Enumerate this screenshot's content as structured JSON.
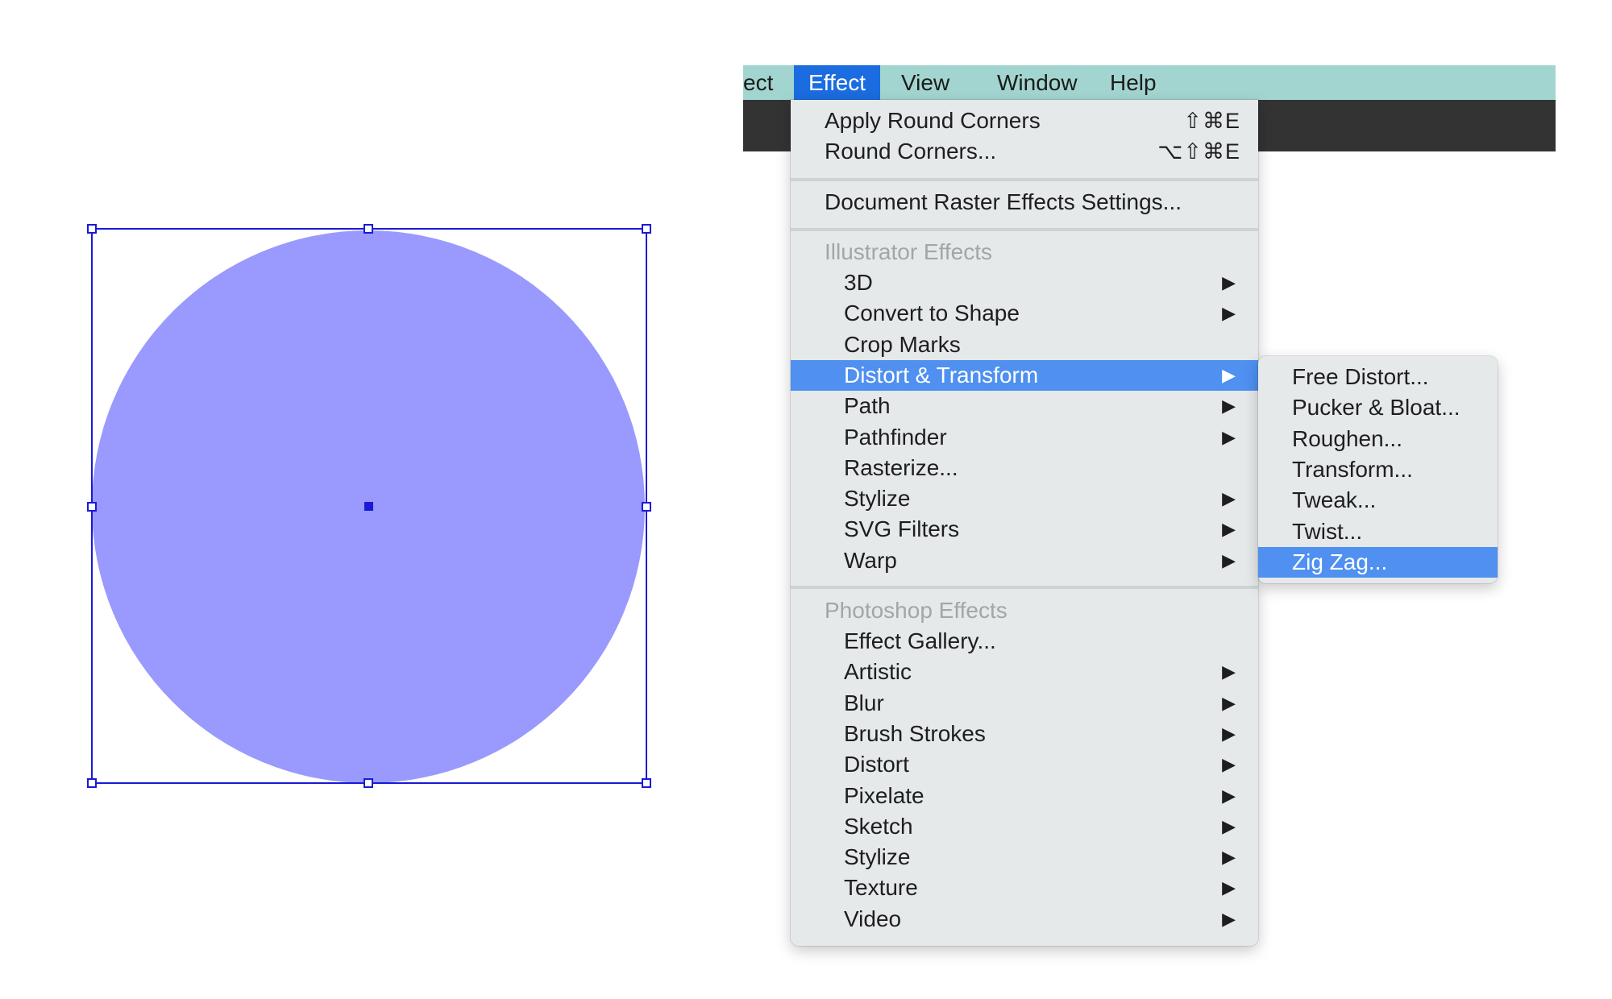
{
  "canvas": {
    "shape_fill": "#9999fe",
    "selection_color": "#1a1ad6"
  },
  "menubar": {
    "items": [
      "ect",
      "Effect",
      "View",
      "Window",
      "Help"
    ],
    "active": "Effect",
    "bg": "#a3d5d0",
    "active_bg": "#1b6ce0"
  },
  "effect_menu": {
    "top_items": [
      {
        "label": "Apply Round Corners",
        "shortcut": "⇧⌘E"
      },
      {
        "label": "Round Corners...",
        "shortcut": "⌥⇧⌘E"
      }
    ],
    "document_item": "Document Raster Effects Settings...",
    "illustrator_header": "Illustrator Effects",
    "illustrator_items": [
      {
        "label": "3D",
        "submenu": true
      },
      {
        "label": "Convert to Shape",
        "submenu": true
      },
      {
        "label": "Crop Marks",
        "submenu": false
      },
      {
        "label": "Distort & Transform",
        "submenu": true,
        "highlighted": true
      },
      {
        "label": "Path",
        "submenu": true
      },
      {
        "label": "Pathfinder",
        "submenu": true
      },
      {
        "label": "Rasterize...",
        "submenu": false
      },
      {
        "label": "Stylize",
        "submenu": true
      },
      {
        "label": "SVG Filters",
        "submenu": true
      },
      {
        "label": "Warp",
        "submenu": true
      }
    ],
    "photoshop_header": "Photoshop Effects",
    "photoshop_items": [
      {
        "label": "Effect Gallery...",
        "submenu": false
      },
      {
        "label": "Artistic",
        "submenu": true
      },
      {
        "label": "Blur",
        "submenu": true
      },
      {
        "label": "Brush Strokes",
        "submenu": true
      },
      {
        "label": "Distort",
        "submenu": true
      },
      {
        "label": "Pixelate",
        "submenu": true
      },
      {
        "label": "Sketch",
        "submenu": true
      },
      {
        "label": "Stylize",
        "submenu": true
      },
      {
        "label": "Texture",
        "submenu": true
      },
      {
        "label": "Video",
        "submenu": true
      }
    ],
    "arrow_glyph": "▶",
    "highlight_color": "#4f90f0"
  },
  "distort_submenu": {
    "items": [
      "Free Distort...",
      "Pucker & Bloat...",
      "Roughen...",
      "Transform...",
      "Tweak...",
      "Twist...",
      "Zig Zag..."
    ],
    "highlighted": "Zig Zag..."
  }
}
